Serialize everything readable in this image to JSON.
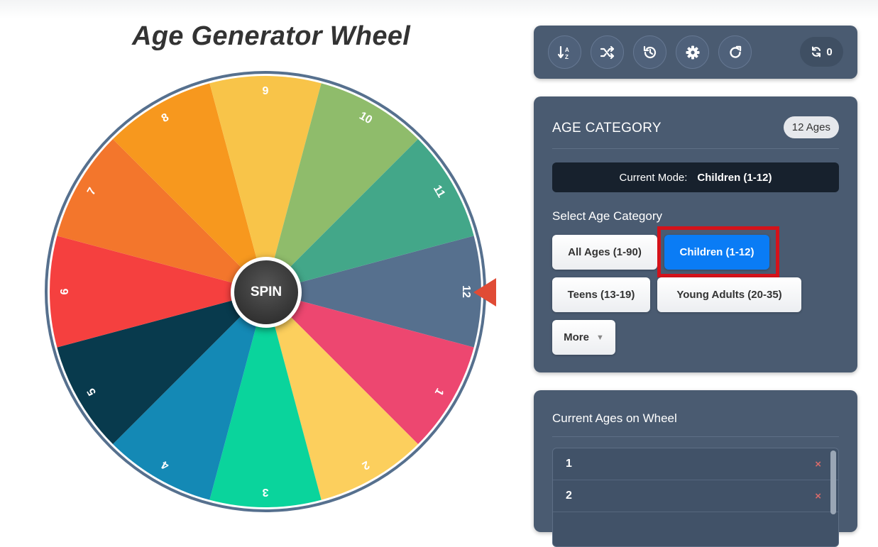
{
  "page": {
    "title": "Age Generator Wheel"
  },
  "wheel": {
    "spin_label": "SPIN",
    "segments": [
      {
        "label": "12",
        "color": "#56708e"
      },
      {
        "label": "1",
        "color": "#ed4770"
      },
      {
        "label": "2",
        "color": "#fccf5d"
      },
      {
        "label": "3",
        "color": "#0ad49c"
      },
      {
        "label": "4",
        "color": "#1489b5"
      },
      {
        "label": "5",
        "color": "#083a4d"
      },
      {
        "label": "6",
        "color": "#f5403f"
      },
      {
        "label": "7",
        "color": "#f3762c"
      },
      {
        "label": "8",
        "color": "#f7981e"
      },
      {
        "label": "9",
        "color": "#f8c449"
      },
      {
        "label": "10",
        "color": "#8fbc6b"
      },
      {
        "label": "11",
        "color": "#43a789"
      }
    ],
    "rim_color": "#56708e",
    "pointer_color": "#e04b35"
  },
  "toolbar": {
    "buttons": [
      {
        "name": "sort-button",
        "icon": "sort-icon"
      },
      {
        "name": "shuffle-button",
        "icon": "shuffle-icon"
      },
      {
        "name": "history-button",
        "icon": "history-icon"
      },
      {
        "name": "settings-button",
        "icon": "gear-icon"
      },
      {
        "name": "reset-button",
        "icon": "refresh-icon"
      }
    ],
    "spin_count": "0"
  },
  "category": {
    "heading": "AGE CATEGORY",
    "count_badge": "12 Ages",
    "mode_label": "Current Mode:",
    "mode_value": "Children (1-12)",
    "select_label": "Select Age Category",
    "buttons": {
      "all": "All Ages (1-90)",
      "children": "Children (1-12)",
      "teens": "Teens (13-19)",
      "young_adults": "Young Adults (20-35)",
      "more": "More"
    },
    "active": "children"
  },
  "ages": {
    "heading": "Current Ages on Wheel",
    "items": [
      "1",
      "2"
    ],
    "remove_symbol": "×"
  }
}
